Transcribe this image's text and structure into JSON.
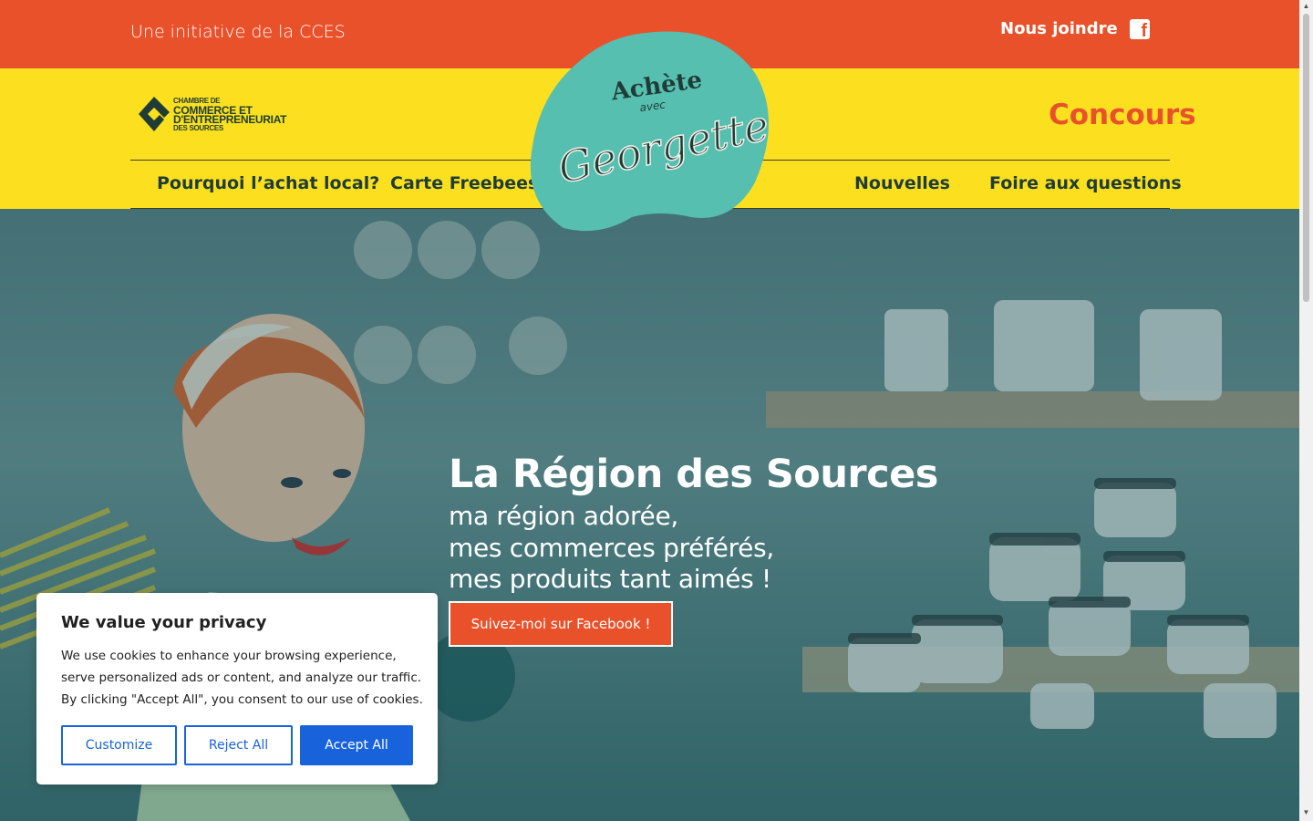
{
  "topbar": {
    "initiative": "Une initiative de la CCES",
    "join_label": "Nous joindre",
    "facebook_glyph": "f"
  },
  "header": {
    "logo_lines": [
      "CHAMBRE DE",
      "COMMERCE ET",
      "D'ENTREPRENEURIAT",
      "DES SOURCES"
    ],
    "concours": "Concours",
    "nav": [
      "Pourquoi l’achat local?",
      "Carte Freebees",
      "Nouvelles",
      "Foire aux questions"
    ],
    "brand": {
      "line1": "Achète",
      "line2": "avec",
      "line3": "Georgette"
    }
  },
  "hero": {
    "title": "La Région des Sources",
    "lines": [
      "ma région adorée,",
      "mes commerces préférés,",
      "mes produits tant aimés !"
    ],
    "button": "Suivez-moi sur Facebook !"
  },
  "cookie": {
    "title": "We value your privacy",
    "text": "We use cookies to enhance your browsing experience, serve personalized ads or content, and analyze our traffic. By clicking \"Accept All\", you consent to our use of cookies.",
    "customize": "Customize",
    "reject": "Reject All",
    "accept": "Accept All"
  },
  "colors": {
    "orange": "#e9512b",
    "yellow": "#fce01f",
    "teal": "#56bfb0",
    "dark": "#1f3d36",
    "accept_blue": "#1863dc"
  },
  "icons": [
    "facebook-icon",
    "cces-logo-icon"
  ]
}
